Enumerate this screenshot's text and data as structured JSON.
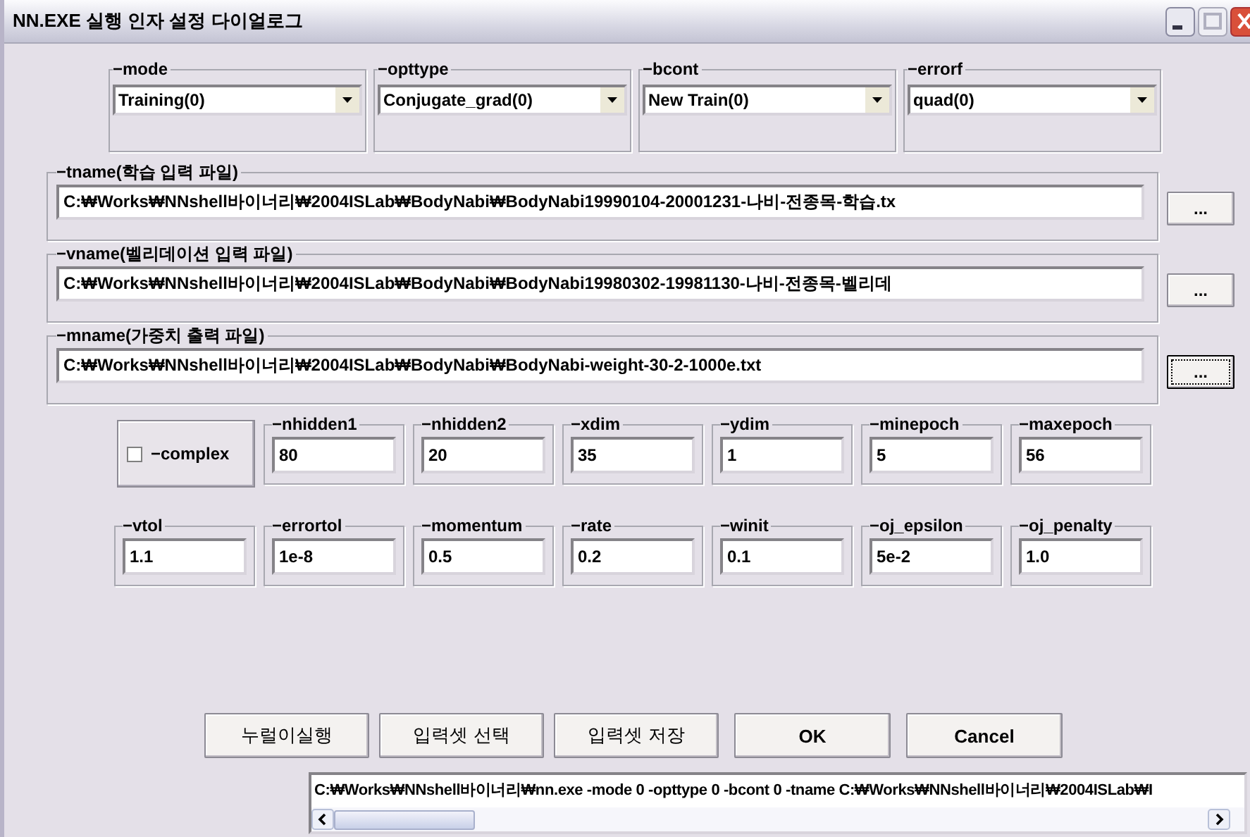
{
  "window": {
    "title": "NN.EXE 실행 인자 설정 다이얼로그"
  },
  "combos": [
    {
      "label": "−mode",
      "value": "Training(0)"
    },
    {
      "label": "−opttype",
      "value": "Conjugate_grad(0)"
    },
    {
      "label": "−bcont",
      "value": "New Train(0)"
    },
    {
      "label": "−errorf",
      "value": "quad(0)"
    }
  ],
  "files": [
    {
      "label": "−tname(학습 입력 파일)",
      "value": "C:₩Works₩NNshell바이너리₩2004ISLab₩BodyNabi₩BodyNabi19990104-20001231-나비-전종목-학습.tx",
      "button": "...",
      "focused": false
    },
    {
      "label": "−vname(벨리데이션 입력 파일)",
      "value": "C:₩Works₩NNshell바이너리₩2004ISLab₩BodyNabi₩BodyNabi19980302-19981130-나비-전종목-벨리데",
      "button": "...",
      "focused": false
    },
    {
      "label": "−mname(가중치 출력 파일)",
      "value": "C:₩Works₩NNshell바이너리₩2004ISLab₩BodyNabi₩BodyNabi-weight-30-2-1000e.txt",
      "button": "...",
      "focused": true
    }
  ],
  "complex": {
    "label": "−complex",
    "checked": false
  },
  "params": [
    [
      {
        "label": "−nhidden1",
        "value": "80"
      },
      {
        "label": "−nhidden2",
        "value": "20"
      },
      {
        "label": "−xdim",
        "value": "35"
      },
      {
        "label": "−ydim",
        "value": "1"
      },
      {
        "label": "−minepoch",
        "value": "5"
      },
      {
        "label": "−maxepoch",
        "value": "56"
      }
    ],
    [
      {
        "label": "−vtol",
        "value": "1.1"
      },
      {
        "label": "−errortol",
        "value": "1e-8"
      },
      {
        "label": "−momentum",
        "value": "0.5"
      },
      {
        "label": "−rate",
        "value": "0.2"
      },
      {
        "label": "−winit",
        "value": "0.1"
      },
      {
        "label": "−oj_epsilon",
        "value": "5e-2"
      },
      {
        "label": "−oj_penalty",
        "value": "1.0"
      }
    ]
  ],
  "buttons": [
    {
      "label": "누럴이실행",
      "bold": false
    },
    {
      "label": "입력셋 선택",
      "bold": false
    },
    {
      "label": "입력셋 저장",
      "bold": false
    },
    {
      "label": "OK",
      "bold": true
    },
    {
      "label": "Cancel",
      "bold": true
    }
  ],
  "command": {
    "value": "C:₩Works₩NNshell바이너리₩nn.exe -mode 0 -opttype 0 -bcont 0 -tname C:₩Works₩NNshell바이너리₩2004ISLab₩I"
  }
}
